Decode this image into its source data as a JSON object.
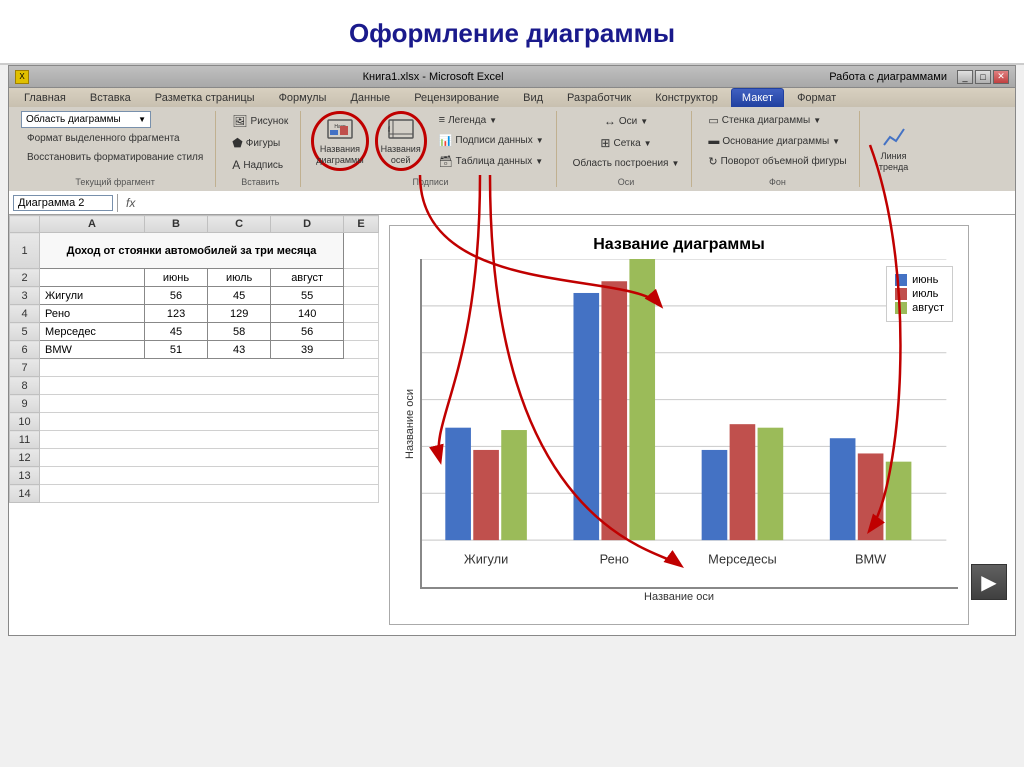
{
  "title": "Оформление диаграммы",
  "excel": {
    "titlebar": "Книга1.xlsx - Microsoft Excel",
    "right_title": "Работа с диаграммами",
    "tabs": [
      "Главная",
      "Вставка",
      "Разметка страницы",
      "Формулы",
      "Данные",
      "Рецензирование",
      "Вид",
      "Разработчик",
      "Конструктор",
      "Макет",
      "Формат"
    ],
    "active_tab": "Макет",
    "name_box": "Диаграмма 2",
    "groups": {
      "tekuschiy": "Текущий фрагмент",
      "vstavit": "Вставить",
      "podpisi": "Подписи",
      "osi": "Оси",
      "fon": "Фон"
    },
    "buttons": {
      "oblast": "Область диаграммы",
      "format_fragment": "Формат выделенного фрагмента",
      "vosstanovit": "Восстановить форматирование стиля",
      "risunok": "Рисунок",
      "figury": "Фигуры",
      "nadpis": "Надпись",
      "nazvanie_diagrammy": "Названия\nдиаграммы",
      "nazvanie_osei": "Названия\nосей",
      "legenda": "Легенда",
      "podpisi_dannych": "Подписи данных",
      "tablica_dannych": "Таблица данных",
      "osi_btn": "Оси",
      "setka": "Сетка",
      "oblast_postr": "Область\nпостроения",
      "stenka": "Стенка диаграммы",
      "osnovanie": "Основание диаграммы",
      "povorot": "Поворот объемной фигуры",
      "liniya": "Линия\nтренда"
    }
  },
  "spreadsheet": {
    "table_title": "Доход от стоянки автомобилей за три месяца",
    "headers": [
      "июнь",
      "июль",
      "август"
    ],
    "rows": [
      {
        "name": "Жигули",
        "values": [
          56,
          45,
          55
        ]
      },
      {
        "name": "Рено",
        "values": [
          123,
          129,
          140
        ]
      },
      {
        "name": "Мерседес",
        "values": [
          45,
          58,
          56
        ]
      },
      {
        "name": "BMW",
        "values": [
          51,
          43,
          39
        ]
      }
    ]
  },
  "chart": {
    "title": "Название диаграммы",
    "y_axis_label": "Название оси",
    "x_axis_label": "Название оси",
    "categories": [
      "Жигули",
      "Рено",
      "Мерседесы",
      "BMW"
    ],
    "series": [
      {
        "name": "июнь",
        "color": "#4472c4",
        "values": [
          56,
          123,
          45,
          51
        ]
      },
      {
        "name": "июль",
        "color": "#c0504d",
        "values": [
          45,
          129,
          58,
          43
        ]
      },
      {
        "name": "август",
        "color": "#9bbb59",
        "values": [
          55,
          140,
          56,
          39
        ]
      }
    ],
    "y_max": 140,
    "y_ticks": [
      0,
      20,
      40,
      60,
      80,
      100,
      120,
      140
    ]
  },
  "nav": {
    "next_icon": "▶"
  }
}
